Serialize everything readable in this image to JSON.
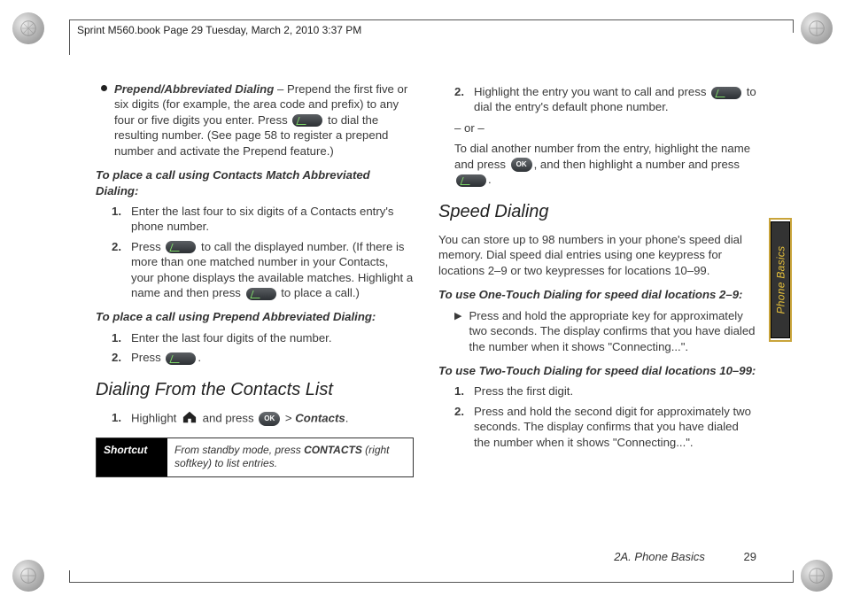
{
  "crop_header": "Sprint M560.book  Page 29  Tuesday, March 2, 2010  3:37 PM",
  "side_tab_label": "Phone Basics",
  "footer": {
    "section": "2A. Phone Basics",
    "page_number": "29"
  },
  "left": {
    "bullet_label": "Prepend/Abbreviated Dialing",
    "bullet_text_a": " – Prepend the first five or six digits (for example, the area code and prefix) to any four or five digits you enter. Press ",
    "bullet_text_b": " to dial the resulting number. (See page 58 to register a prepend number and activate the Prepend feature.)",
    "sub1": "To place a call using Contacts Match Abbreviated Dialing:",
    "s1_1": "Enter the last four to six digits of a Contacts entry's phone number.",
    "s1_2a": "Press ",
    "s1_2b": " to call the displayed number. (If there is more than one matched number in your Contacts, your phone displays the available matches. Highlight a name and then press ",
    "s1_2c": " to place a call.)",
    "sub2": "To place a call using Prepend Abbreviated Dialing:",
    "s2_1": "Enter the last four digits of the number.",
    "s2_2a": "Press ",
    "s2_2b": ".",
    "h2": "Dialing From the Contacts List",
    "s3_1a": "Highlight ",
    "s3_1b": " and press ",
    "s3_1c": " > ",
    "s3_contacts": "Contacts",
    "s3_1d": ".",
    "shortcut_label": "Shortcut",
    "shortcut_text_a": "From standby mode, press ",
    "shortcut_contacts": "CONTACTS",
    "shortcut_text_b": " (right softkey) to list entries."
  },
  "right": {
    "s1_2a": "Highlight the entry you want to call and press ",
    "s1_2b": " to dial the entry's default phone number.",
    "or": "– or –",
    "s1_alt_a": "To dial another number from the entry, highlight the name and press ",
    "s1_alt_b": ", and then highlight a number and press ",
    "s1_alt_c": ".",
    "h2": "Speed Dialing",
    "para": "You can store up to 98 numbers in your phone's speed dial memory. Dial speed dial entries using one keypress for locations 2–9 or two keypresses for locations 10–99.",
    "sub1": "To use One-Touch Dialing for speed dial locations 2–9:",
    "arr1": "Press and hold the appropriate key for approximately two seconds. The display confirms that you have dialed the number when it shows \"Connecting...\".",
    "sub2": "To use Two-Touch Dialing for speed dial locations 10–99:",
    "t2_1": "Press the first digit.",
    "t2_2": "Press and hold the second digit for approximately two seconds. The display confirms that you have dialed the number when it shows \"Connecting...\"."
  },
  "icons": {
    "ok_label": "OK"
  }
}
